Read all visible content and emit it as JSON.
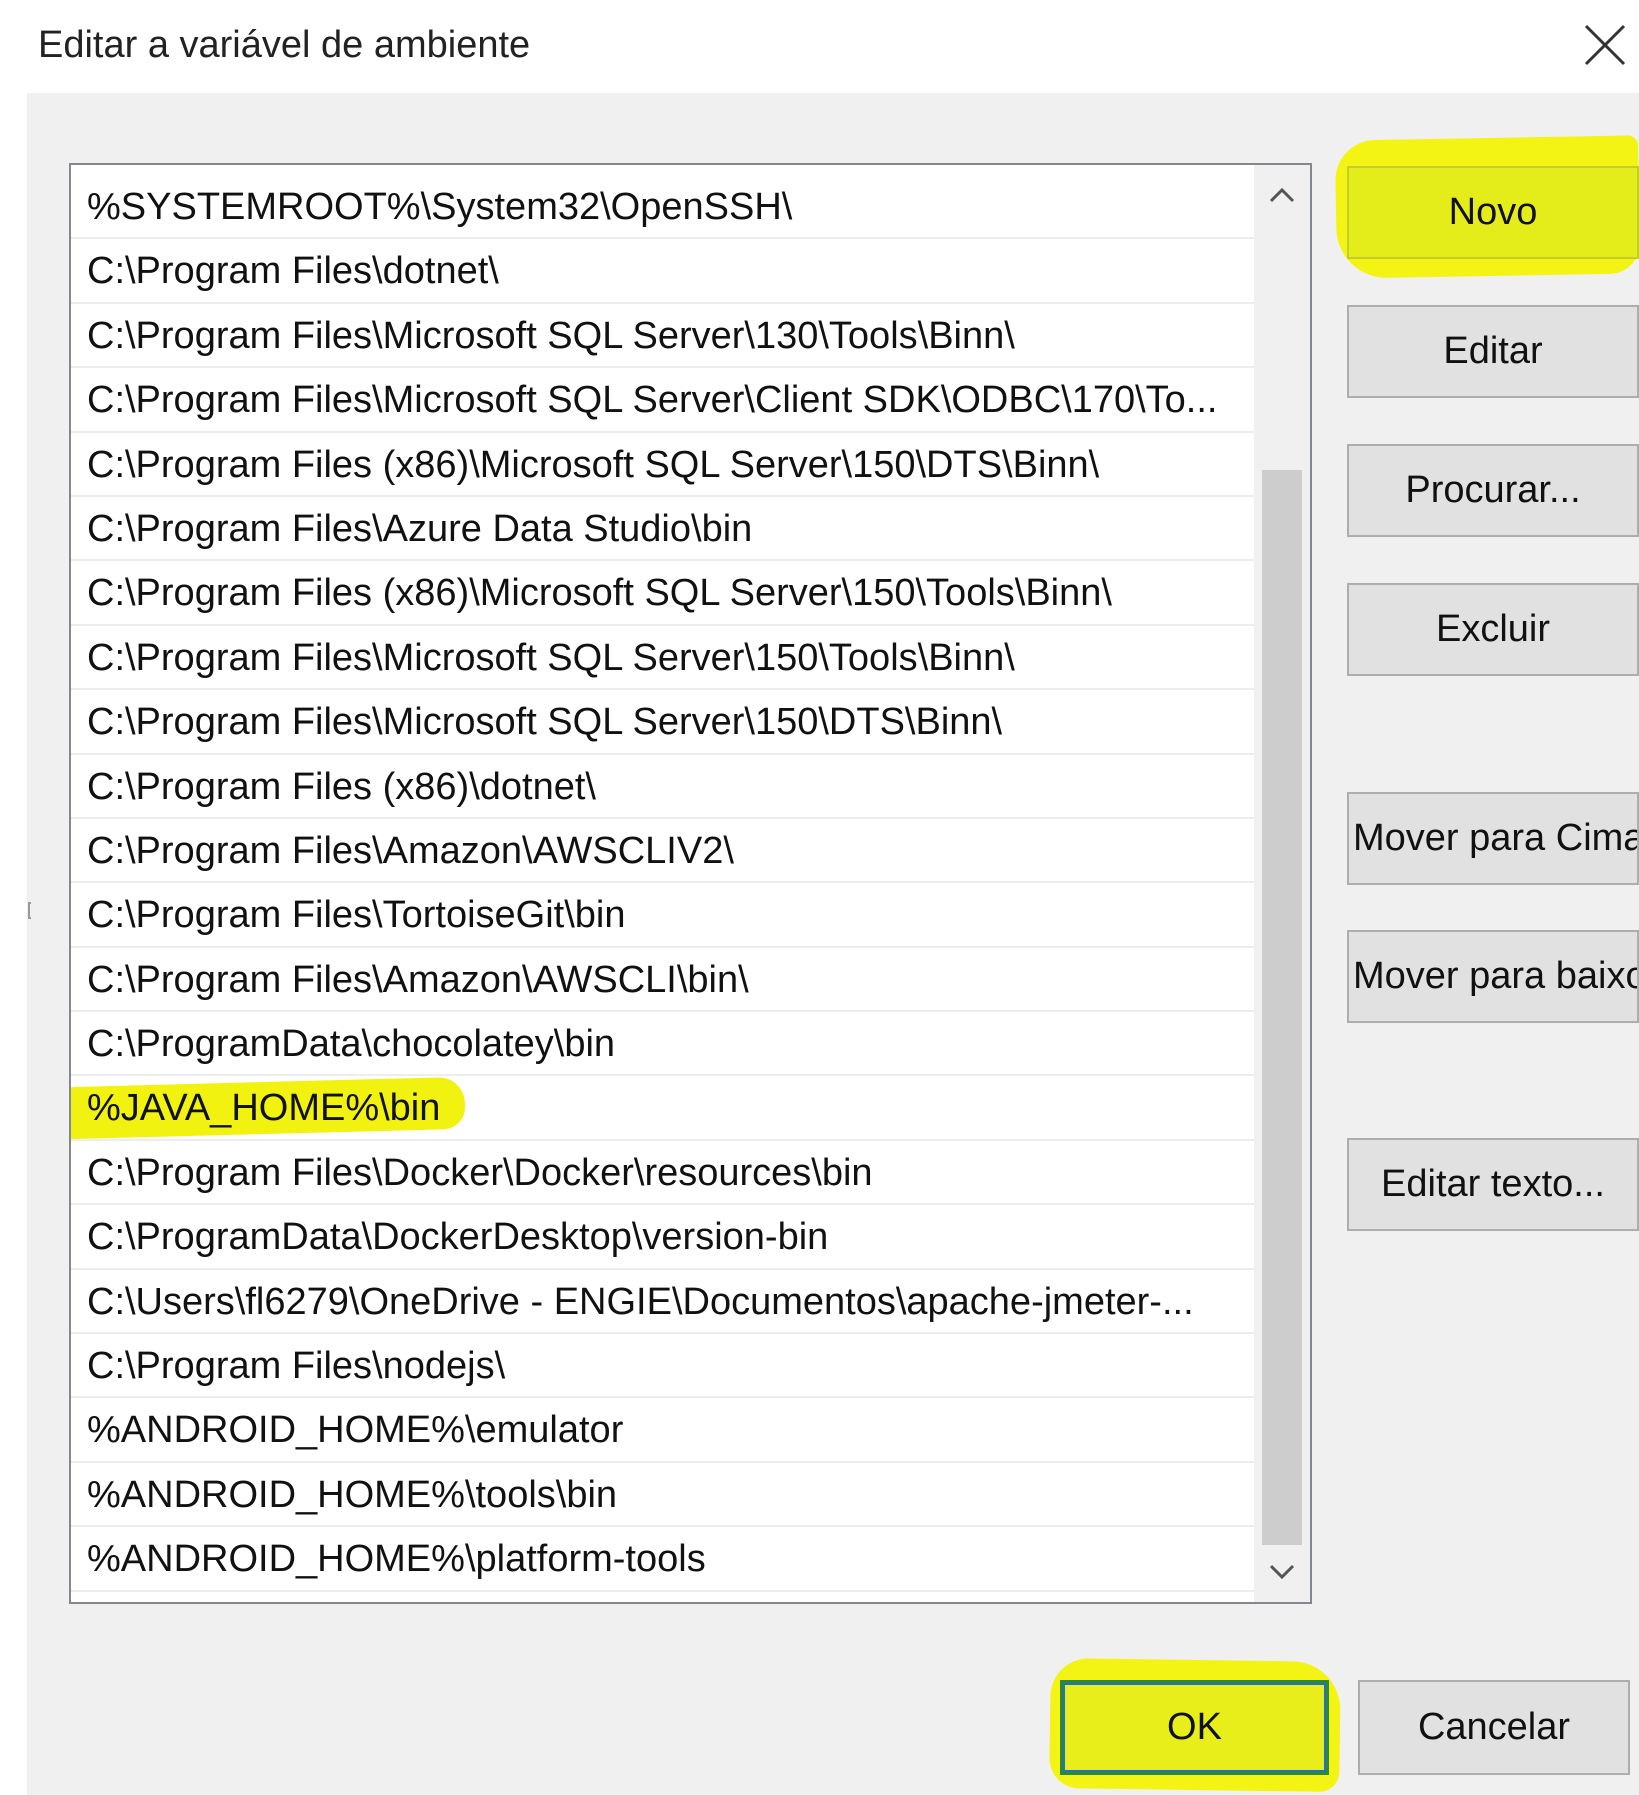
{
  "window": {
    "title": "Editar a variável de ambiente"
  },
  "path_list": {
    "items": [
      "%SYSTEMROOT%\\System32\\OpenSSH\\",
      "C:\\Program Files\\dotnet\\",
      "C:\\Program Files\\Microsoft SQL Server\\130\\Tools\\Binn\\",
      "C:\\Program Files\\Microsoft SQL Server\\Client SDK\\ODBC\\170\\To...",
      "C:\\Program Files (x86)\\Microsoft SQL Server\\150\\DTS\\Binn\\",
      "C:\\Program Files\\Azure Data Studio\\bin",
      "C:\\Program Files (x86)\\Microsoft SQL Server\\150\\Tools\\Binn\\",
      "C:\\Program Files\\Microsoft SQL Server\\150\\Tools\\Binn\\",
      "C:\\Program Files\\Microsoft SQL Server\\150\\DTS\\Binn\\",
      "C:\\Program Files (x86)\\dotnet\\",
      "C:\\Program Files\\Amazon\\AWSCLIV2\\",
      "C:\\Program Files\\TortoiseGit\\bin",
      "C:\\Program Files\\Amazon\\AWSCLI\\bin\\",
      "C:\\ProgramData\\chocolatey\\bin",
      "%JAVA_HOME%\\bin",
      "C:\\Program Files\\Docker\\Docker\\resources\\bin",
      "C:\\ProgramData\\DockerDesktop\\version-bin",
      "C:\\Users\\fl6279\\OneDrive - ENGIE\\Documentos\\apache-jmeter-...",
      "C:\\Program Files\\nodejs\\",
      "%ANDROID_HOME%\\emulator",
      "%ANDROID_HOME%\\tools\\bin",
      "%ANDROID_HOME%\\platform-tools"
    ],
    "highlighted_index": 14
  },
  "buttons": {
    "novo": "Novo",
    "editar": "Editar",
    "procurar": "Procurar...",
    "excluir": "Excluir",
    "mover_cima": "Mover para Cima",
    "mover_baixo": "Mover para baixo",
    "editar_texto": "Editar texto...",
    "ok": "OK",
    "cancelar": "Cancelar"
  },
  "icons": {
    "close": "close-icon",
    "scroll_up": "chevron-up-icon",
    "scroll_down": "chevron-down-icon"
  },
  "colors": {
    "highlight": "#f3f314",
    "ok_border": "#2f8a2f",
    "dialog_background": "#f0f0f0"
  }
}
